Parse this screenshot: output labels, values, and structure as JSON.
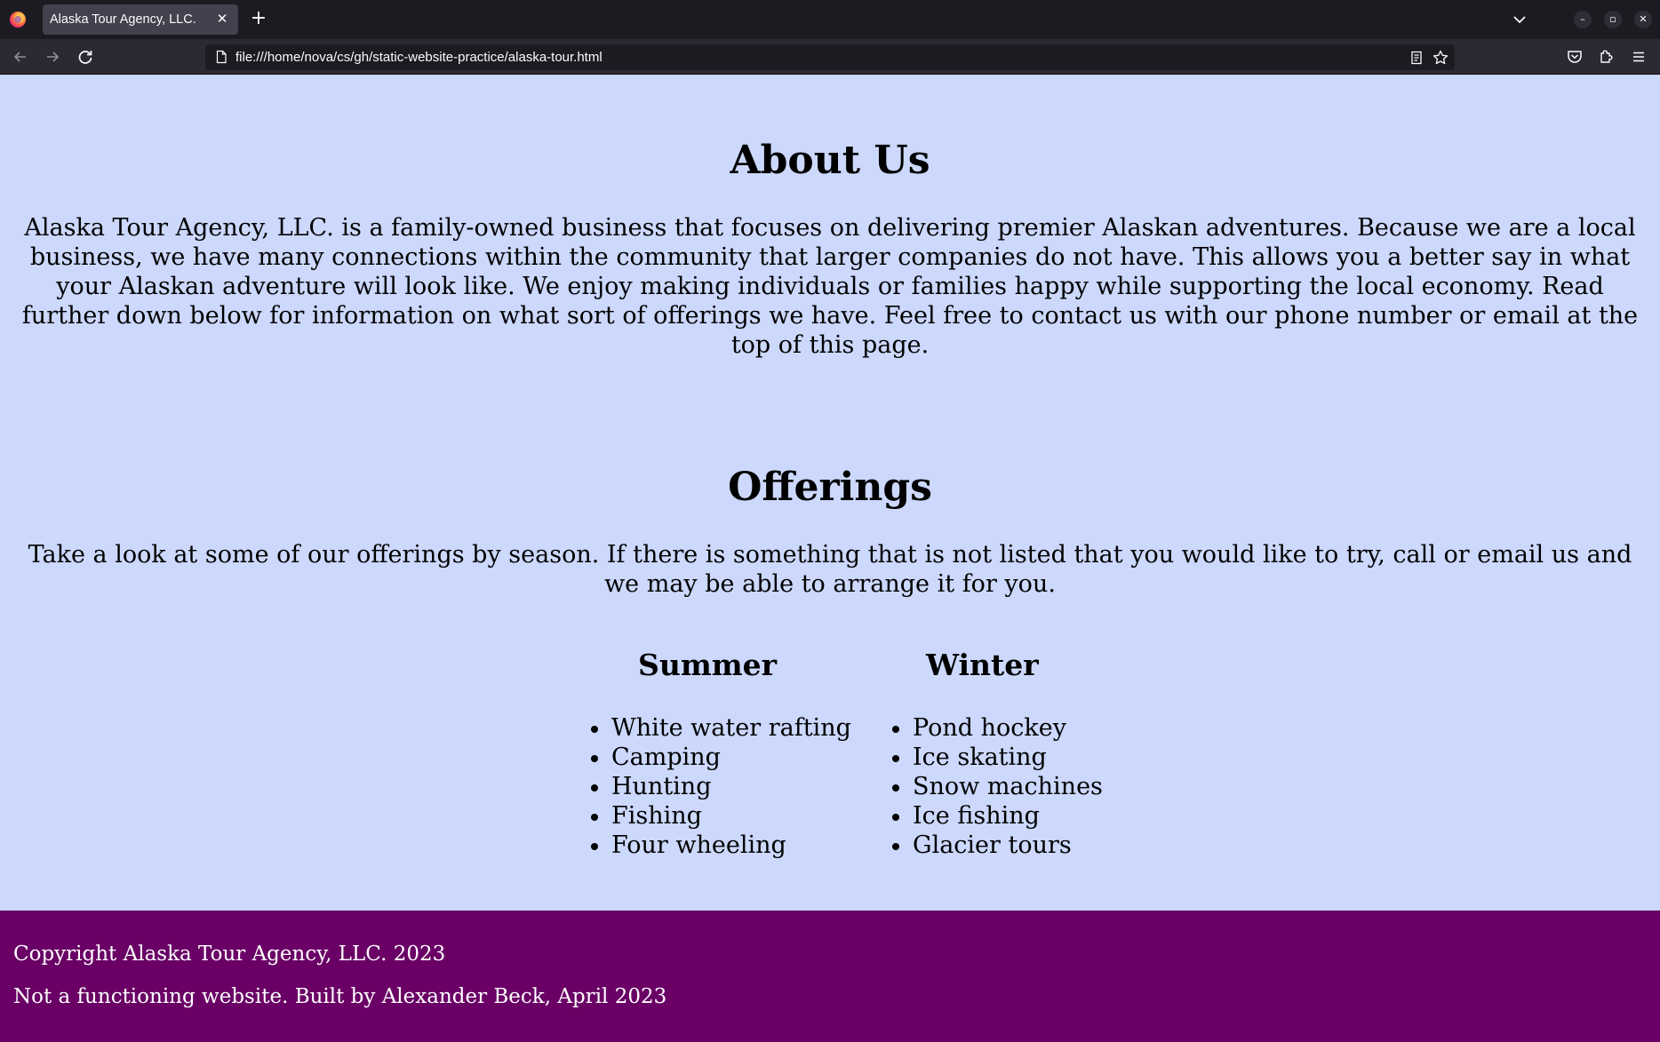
{
  "browser": {
    "tab_title": "Alaska Tour Agency, LLC.",
    "tab_close_glyph": "✕",
    "new_tab_glyph": "+",
    "url": "file:///home/nova/cs/gh/static-website-practice/alaska-tour.html",
    "window_controls": {
      "minimize": "–",
      "restore": "▫",
      "close": "✕"
    },
    "icons": [
      "firefox-logo-icon",
      "back-arrow-icon",
      "forward-arrow-icon",
      "reload-icon",
      "page-icon",
      "reader-view-icon",
      "bookmark-star-icon",
      "pocket-icon",
      "extensions-icon",
      "menu-icon",
      "tab-list-chevron-icon"
    ]
  },
  "about": {
    "heading": "About Us",
    "text": "Alaska Tour Agency, LLC. is a family-owned business that focuses on delivering premier Alaskan adventures. Because we are a local business, we have many connections within the community that larger companies do not have. This allows you a better say in what your Alaskan adventure will look like. We enjoy making individuals or families happy while supporting the local economy. Read further down below for information on what sort of offerings we have. Feel free to contact us with our phone number or email at the top of this page."
  },
  "offerings": {
    "heading": "Offerings",
    "text": "Take a look at some of our offerings by season. If there is something that is not listed that you would like to try, call or email us and we may be able to arrange it for you.",
    "summer": {
      "heading": "Summer",
      "items": [
        "White water rafting",
        "Camping",
        "Hunting",
        "Fishing",
        "Four wheeling"
      ]
    },
    "winter": {
      "heading": "Winter",
      "items": [
        "Pond hockey",
        "Ice skating",
        "Snow machines",
        "Ice fishing",
        "Glacier tours"
      ]
    }
  },
  "footer": {
    "copyright": "Copyright Alaska Tour Agency, LLC. 2023",
    "note": "Not a functioning website. Built by Alexander Beck, April 2023"
  },
  "colors": {
    "page_background": "#ccd8fc",
    "footer_background": "#6a0066",
    "footer_text": "#ffffff",
    "chrome_tabbar": "#1c1b22",
    "chrome_toolbar": "#2b2a33"
  }
}
